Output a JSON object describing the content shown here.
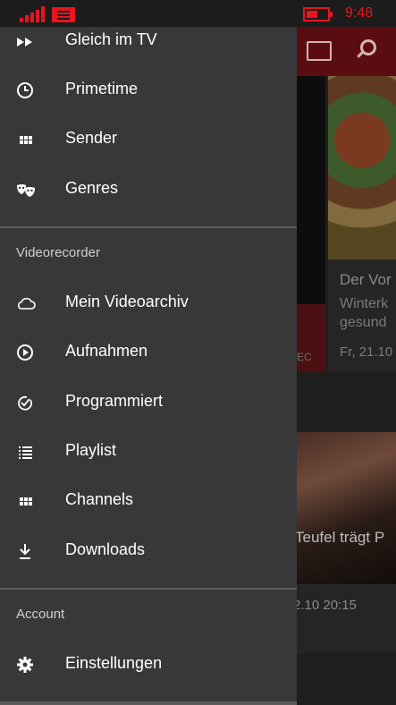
{
  "status_bar": {
    "time": "9:48",
    "accent": "#e8141e"
  },
  "background": {
    "food_tile": {
      "title": "Der Vor",
      "subtitle_line1": "Winterk",
      "subtitle_line2": "gesund",
      "date": "Fr, 21.10"
    },
    "tag": "EC",
    "movie_tile": {
      "title": "Teufel trägt P",
      "time": "2.10   20:15"
    }
  },
  "drawer": {
    "items_top": [
      {
        "label": "Gleich im TV",
        "icon": "fast-forward-icon"
      },
      {
        "label": "Primetime",
        "icon": "clock-icon"
      },
      {
        "label": "Sender",
        "icon": "grid-icon"
      },
      {
        "label": "Genres",
        "icon": "masks-icon"
      }
    ],
    "section_videorecorder": "Videorecorder",
    "items_recorder": [
      {
        "label": "Mein Videoarchiv",
        "icon": "cloud-icon"
      },
      {
        "label": "Aufnahmen",
        "icon": "play-circle-icon"
      },
      {
        "label": "Programmiert",
        "icon": "check-clock-icon"
      },
      {
        "label": "Playlist",
        "icon": "list-icon"
      },
      {
        "label": "Channels",
        "icon": "grid-icon"
      },
      {
        "label": "Downloads",
        "icon": "download-icon"
      }
    ],
    "section_account": "Account",
    "items_account": [
      {
        "label": "Einstellungen",
        "icon": "gear-icon"
      }
    ]
  }
}
